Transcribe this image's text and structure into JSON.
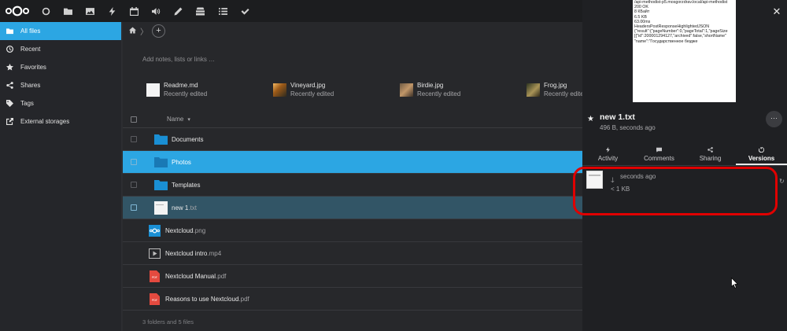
{
  "topbar": {
    "logo": "nextcloud-logo",
    "apps": [
      {
        "name": "dashboard-icon",
        "glyph": "○"
      },
      {
        "name": "files-icon",
        "glyph": "folder"
      },
      {
        "name": "photos-icon",
        "glyph": "image"
      },
      {
        "name": "activity-icon",
        "glyph": "bolt"
      },
      {
        "name": "calendar-icon",
        "glyph": "calendar"
      },
      {
        "name": "audio-icon",
        "glyph": "speaker"
      },
      {
        "name": "notes-icon",
        "glyph": "pen"
      },
      {
        "name": "deck-icon",
        "glyph": "stack"
      },
      {
        "name": "list-icon",
        "glyph": "list"
      },
      {
        "name": "tasks-icon",
        "glyph": "check"
      }
    ]
  },
  "sidebar": {
    "items": [
      {
        "label": "All files",
        "icon": "folder-icon"
      },
      {
        "label": "Recent",
        "icon": "clock-icon"
      },
      {
        "label": "Favorites",
        "icon": "star-icon"
      },
      {
        "label": "Shares",
        "icon": "share-icon"
      },
      {
        "label": "Tags",
        "icon": "tag-icon"
      },
      {
        "label": "External storages",
        "icon": "external-icon"
      }
    ]
  },
  "main": {
    "add_symbol": "+",
    "notes_placeholder": "Add notes, lists or links …",
    "recent": [
      {
        "name": "Readme.md",
        "sub": "Recently edited"
      },
      {
        "name": "Vineyard.jpg",
        "sub": "Recently edited"
      },
      {
        "name": "Birdie.jpg",
        "sub": "Recently edited"
      },
      {
        "name": "Frog.jpg",
        "sub": "Recently edited"
      }
    ],
    "column_name": "Name",
    "files": [
      {
        "name": "Documents",
        "ext": "",
        "type": "folder"
      },
      {
        "name": "Photos",
        "ext": "",
        "type": "folder"
      },
      {
        "name": "Templates",
        "ext": "",
        "type": "folder"
      },
      {
        "name": "new 1",
        "ext": ".txt",
        "type": "txt"
      },
      {
        "name": "Nextcloud",
        "ext": ".png",
        "type": "png"
      },
      {
        "name": "Nextcloud intro",
        "ext": ".mp4",
        "type": "video"
      },
      {
        "name": "Nextcloud Manual",
        "ext": ".pdf",
        "type": "pdf"
      },
      {
        "name": "Reasons to use Nextcloud",
        "ext": ".pdf",
        "type": "pdf"
      }
    ],
    "summary": "3 folders and 5 files"
  },
  "details": {
    "preview_lines": [
      "/api-methodist-p5.mosgorzdrav.local/api-methodist",
      "200 OK",
      "8 КБайт",
      "6.5 KB",
      "63.00ms",
      "HeadersPostResponseHighlightedJSON",
      "{\"result\":{\"pageNumber\":0,\"pageTotal\":1,\"pageSize",
      "[{\"id\":200001294127,\"archived\":false,\"shortName\"",
      "\"name\":\"Государственное бюдже"
    ],
    "title": "new 1.txt",
    "subtitle": "496 B, seconds ago",
    "more_label": "···",
    "tabs": [
      {
        "label": "Activity",
        "icon": "bolt-icon"
      },
      {
        "label": "Comments",
        "icon": "comment-icon"
      },
      {
        "label": "Sharing",
        "icon": "share-icon"
      },
      {
        "label": "Versions",
        "icon": "restore-icon"
      }
    ],
    "version": {
      "time": "seconds ago",
      "size": "< 1 KB"
    }
  }
}
